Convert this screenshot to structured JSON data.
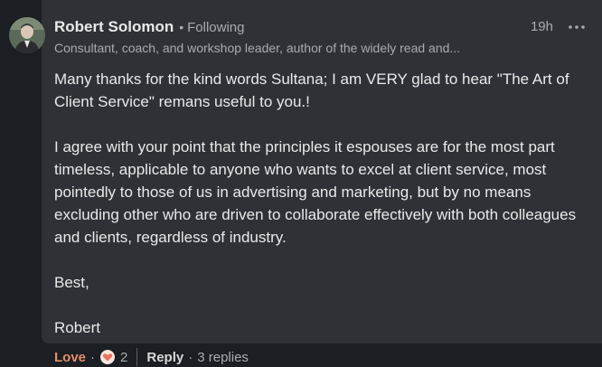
{
  "author": {
    "name": "Robert Solomon",
    "follow_status": "Following",
    "headline": "Consultant, coach, and workshop leader, author of the widely read and..."
  },
  "timestamp": "19h",
  "comment": {
    "paragraphs": [
      "Many thanks for the kind words Sultana; I am VERY glad to hear \"The Art of Client Service\" remans useful to you.!",
      "I agree with your point that the principles it espouses are for the most part timeless, applicable to anyone who wants to excel at client service, most pointedly to those of us in advertising and marketing, but by no means excluding other who are driven to collaborate effectively with both colleagues and clients, regardless of industry.",
      "Best,",
      "Robert"
    ]
  },
  "actions": {
    "love_label": "Love",
    "reaction_count": "2",
    "reply_label": "Reply",
    "replies_label": "3 replies"
  },
  "icons": {
    "more": "more-horizontal-icon",
    "reaction": "heart-reaction-icon"
  },
  "colors": {
    "background": "#1b1f23",
    "card": "#2e3237",
    "love_accent": "#e68e6b",
    "heart": "#e9745b"
  }
}
